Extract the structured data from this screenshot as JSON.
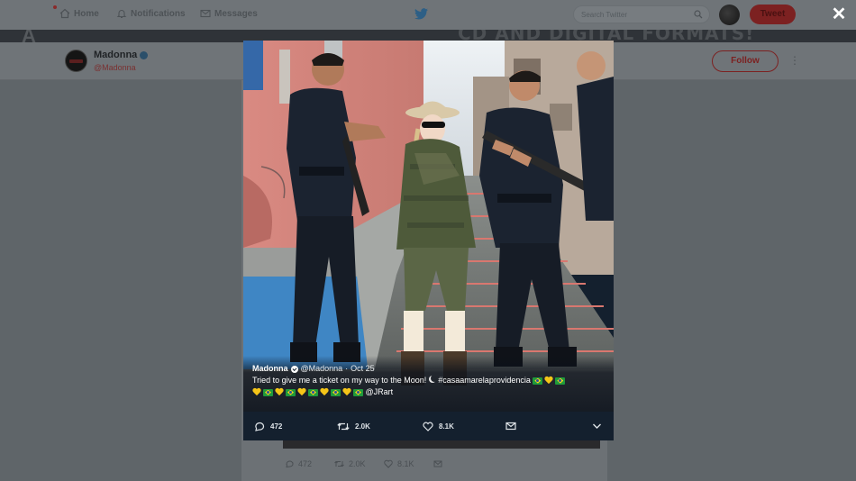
{
  "nav": {
    "home": "Home",
    "notifications": "Notifications",
    "messages": "Messages",
    "search_placeholder": "Search Twitter",
    "tweet": "Tweet"
  },
  "banner": {
    "text": "CD AND DIGITAL FORMATS!",
    "left_glyph": "A"
  },
  "profile": {
    "name": "Madonna",
    "handle": "@Madonna",
    "follow": "Follow"
  },
  "background_tweet": {
    "replies": "472",
    "retweets": "2.0K",
    "likes": "8.1K"
  },
  "modal": {
    "close": "✕",
    "author_name": "Madonna",
    "author_handle": "@Madonna",
    "dot": "·",
    "date": "Oct 25",
    "text_line1": "Tried to give me a ticket on my way to the Moon!",
    "hashtag": "#casaamarelaprovidencia",
    "mention": "@JRart",
    "replies": "472",
    "retweets": "2.0K",
    "likes": "8.1K"
  },
  "colors": {
    "overlay_bg": "#5f6569",
    "modal_bg": "#14202e",
    "brand_red": "#7c2121",
    "emoji_heart": "#f5c518",
    "flag_green": "#1f9a3c"
  },
  "icons": [
    "home-icon",
    "bell-icon",
    "envelope-icon",
    "twitter-bird-icon",
    "search-icon",
    "reply-icon",
    "retweet-icon",
    "like-icon",
    "dm-icon",
    "chevron-down-icon",
    "close-icon",
    "verified-icon"
  ]
}
